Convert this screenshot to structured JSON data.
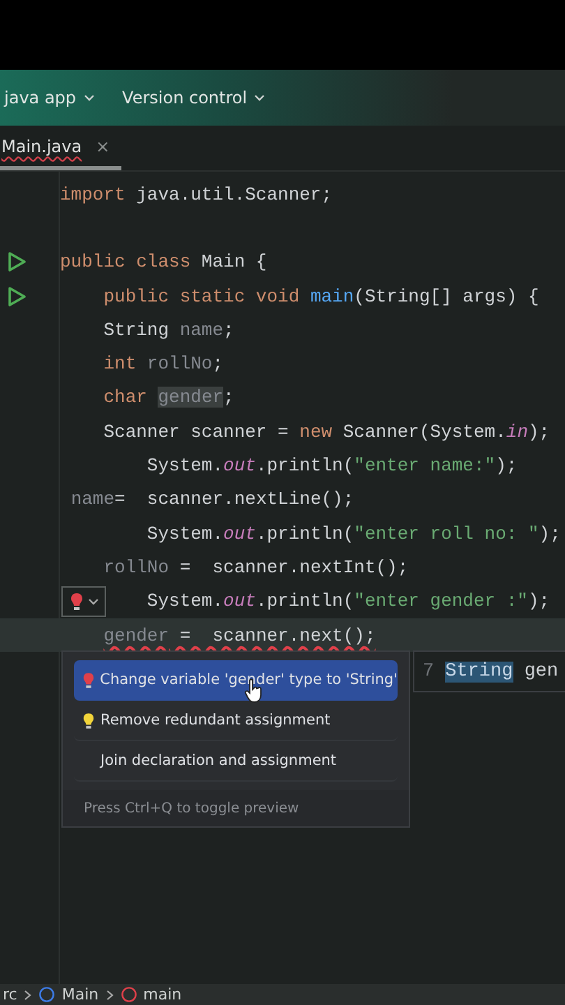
{
  "toolbar": {
    "items": [
      {
        "label": "java app"
      },
      {
        "label": "Version control"
      }
    ]
  },
  "tabs": [
    {
      "label": "Main.java",
      "selected": true,
      "error": true,
      "close": "×"
    }
  ],
  "code": {
    "lines": [
      {
        "kind": "code",
        "current": false,
        "error": false,
        "tokens": [
          {
            "text": "import",
            "kind": "kw"
          },
          {
            "text": " java.util.Scanner;",
            "kind": "plain"
          }
        ]
      },
      {
        "kind": "blank",
        "current": false
      },
      {
        "kind": "run",
        "current": false,
        "error": false,
        "tokens": [
          {
            "text": "public class",
            "kind": "kw"
          },
          {
            "text": " Main {",
            "kind": "plain"
          }
        ]
      },
      {
        "kind": "run",
        "current": false,
        "error": false,
        "tokens": [
          {
            "text": "    public static void",
            "kind": "kw"
          },
          {
            "text": " main",
            "kind": "fn"
          },
          {
            "text": "(String[] args) {",
            "kind": "plain"
          }
        ]
      },
      {
        "kind": "code",
        "current": false,
        "error": false,
        "tokens": [
          {
            "text": "    String ",
            "kind": "plain"
          },
          {
            "text": "name",
            "kind": "unused"
          },
          {
            "text": ";",
            "kind": "plain"
          }
        ]
      },
      {
        "kind": "code",
        "current": false,
        "error": false,
        "tokens": [
          {
            "text": "    int",
            "kind": "kw"
          },
          {
            "text": " rollNo",
            "kind": "unused"
          },
          {
            "text": ";",
            "kind": "plain"
          }
        ]
      },
      {
        "kind": "code",
        "current": false,
        "error": false,
        "tokens": [
          {
            "text": "    char ",
            "kind": "kw"
          },
          {
            "text": "gender",
            "kind": "hl"
          },
          {
            "text": ";",
            "kind": "plain"
          }
        ]
      },
      {
        "kind": "code",
        "current": false,
        "error": false,
        "tokens": [
          {
            "text": "    Scanner scanner = ",
            "kind": "plain"
          },
          {
            "text": "new",
            "kind": "kw"
          },
          {
            "text": " Scanner(System.",
            "kind": "plain"
          },
          {
            "text": "in",
            "kind": "static"
          },
          {
            "text": ");",
            "kind": "plain"
          }
        ]
      },
      {
        "kind": "code",
        "current": false,
        "error": false,
        "tokens": [
          {
            "text": "        System.",
            "kind": "plain"
          },
          {
            "text": "out",
            "kind": "static"
          },
          {
            "text": ".println(",
            "kind": "plain"
          },
          {
            "text": "\"enter name:\"",
            "kind": "str"
          },
          {
            "text": ");",
            "kind": "plain"
          }
        ]
      },
      {
        "kind": "code",
        "current": false,
        "error": false,
        "tokens": [
          {
            "text": " name",
            "kind": "unused"
          },
          {
            "text": "=  scanner.nextLine();",
            "kind": "plain"
          }
        ]
      },
      {
        "kind": "code",
        "current": false,
        "error": false,
        "tokens": [
          {
            "text": "        System.",
            "kind": "plain"
          },
          {
            "text": "out",
            "kind": "static"
          },
          {
            "text": ".println(",
            "kind": "plain"
          },
          {
            "text": "\"enter roll no: \"",
            "kind": "str"
          },
          {
            "text": ");",
            "kind": "plain"
          }
        ]
      },
      {
        "kind": "code",
        "current": false,
        "error": false,
        "tokens": [
          {
            "text": "    rollNo",
            "kind": "unused"
          },
          {
            "text": " =  scanner.nextInt();",
            "kind": "plain"
          }
        ]
      },
      {
        "kind": "quickfix",
        "current": false,
        "error": false,
        "tokens": [
          {
            "text": "        System.",
            "kind": "plain"
          },
          {
            "text": "out",
            "kind": "static"
          },
          {
            "text": ".println(",
            "kind": "plain"
          },
          {
            "text": "\"enter gender :\"",
            "kind": "str"
          },
          {
            "text": ");",
            "kind": "plain"
          }
        ]
      },
      {
        "kind": "code",
        "current": true,
        "error": true,
        "tokens": [
          {
            "text": "    gender",
            "kind": "unused"
          },
          {
            "text": " =  scanner.next();",
            "kind": "plain"
          }
        ]
      }
    ]
  },
  "popup": {
    "items": [
      {
        "kind": "error-fix",
        "label": "Change variable 'gender' type to 'String'",
        "selected": true
      },
      {
        "kind": "fix",
        "label": "Remove redundant assignment",
        "selected": false
      },
      {
        "kind": "action",
        "label": "Join declaration and assignment",
        "selected": false
      }
    ],
    "hint": "Press Ctrl+Q to toggle preview"
  },
  "preview": {
    "line_number": "7",
    "tokens": [
      {
        "text": "String",
        "highlighted": true
      },
      {
        "text": " gen",
        "highlighted": false
      }
    ]
  },
  "breadcrumbs": [
    {
      "kind": "folder",
      "label": "rc"
    },
    {
      "kind": "class",
      "label": "Main"
    },
    {
      "kind": "method",
      "label": "main"
    }
  ]
}
